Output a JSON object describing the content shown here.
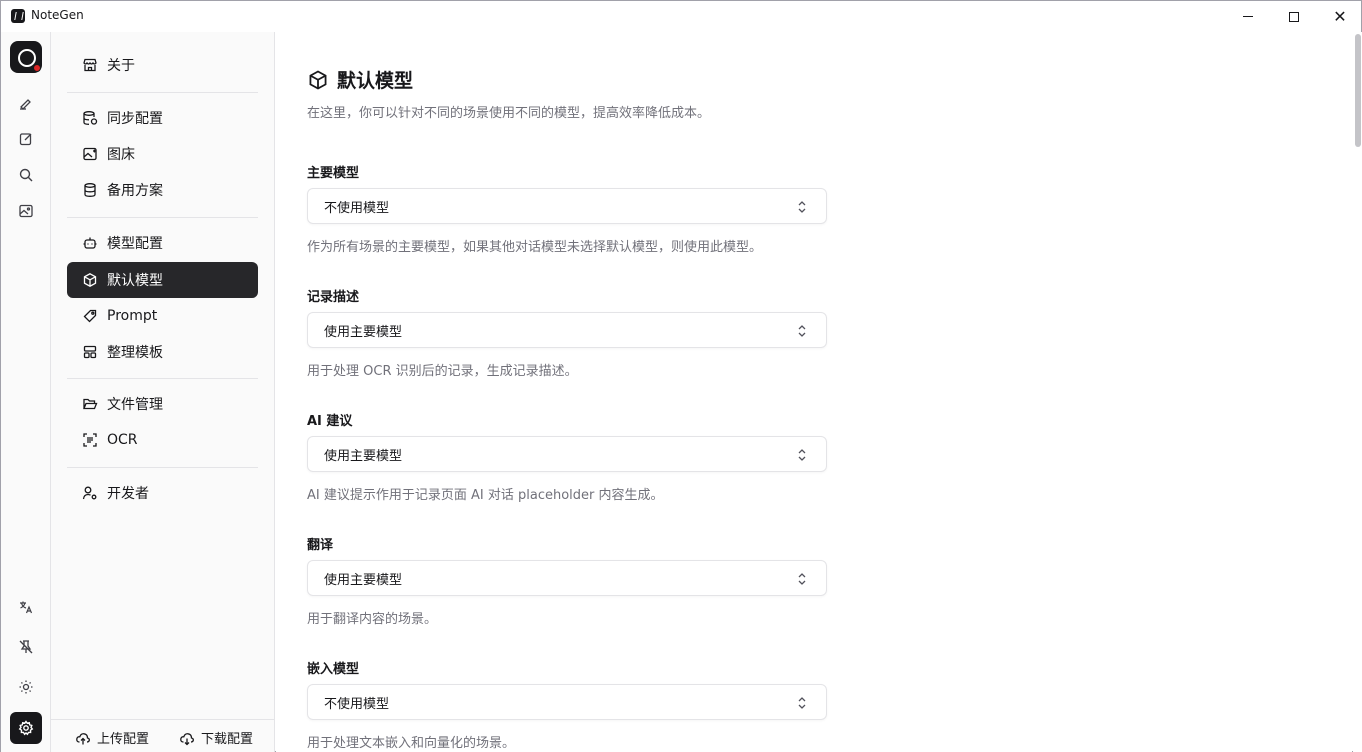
{
  "window": {
    "title": "NoteGen"
  },
  "rail": {
    "icons": [
      "account-icon",
      "pen-icon",
      "edit-icon",
      "search-icon",
      "image-icon"
    ],
    "bottom_icons": [
      "translate-icon",
      "pin-off-icon",
      "sun-icon",
      "settings-icon"
    ]
  },
  "sidebar": {
    "items": [
      {
        "label": "关于",
        "icon": "store-icon"
      },
      {
        "label": "同步配置",
        "icon": "database-sync-icon"
      },
      {
        "label": "图床",
        "icon": "image-plus-icon"
      },
      {
        "label": "备用方案",
        "icon": "database-icon"
      },
      {
        "label": "模型配置",
        "icon": "bot-icon"
      },
      {
        "label": "默认模型",
        "icon": "box-icon"
      },
      {
        "label": "Prompt",
        "icon": "tag-icon"
      },
      {
        "label": "整理模板",
        "icon": "layout-icon"
      },
      {
        "label": "文件管理",
        "icon": "folder-open-icon"
      },
      {
        "label": "OCR",
        "icon": "scan-text-icon"
      },
      {
        "label": "开发者",
        "icon": "user-cog-icon"
      }
    ],
    "active": "默认模型",
    "footer": {
      "upload": "上传配置",
      "download": "下载配置"
    }
  },
  "main": {
    "title": "默认模型",
    "description": "在这里，你可以针对不同的场景使用不同的模型，提高效率降低成本。",
    "sections": [
      {
        "label": "主要模型",
        "value": "不使用模型",
        "help": "作为所有场景的主要模型，如果其他对话模型未选择默认模型，则使用此模型。"
      },
      {
        "label": "记录描述",
        "value": "使用主要模型",
        "help": "用于处理 OCR 识别后的记录，生成记录描述。"
      },
      {
        "label": "AI 建议",
        "value": "使用主要模型",
        "help": "AI 建议提示作用于记录页面 AI 对话 placeholder 内容生成。"
      },
      {
        "label": "翻译",
        "value": "使用主要模型",
        "help": "用于翻译内容的场景。"
      },
      {
        "label": "嵌入模型",
        "value": "不使用模型",
        "help": "用于处理文本嵌入和向量化的场景。"
      }
    ]
  },
  "colors": {
    "active_bg": "#27272a",
    "badge": "#dc2626",
    "muted_text": "#71717a"
  }
}
